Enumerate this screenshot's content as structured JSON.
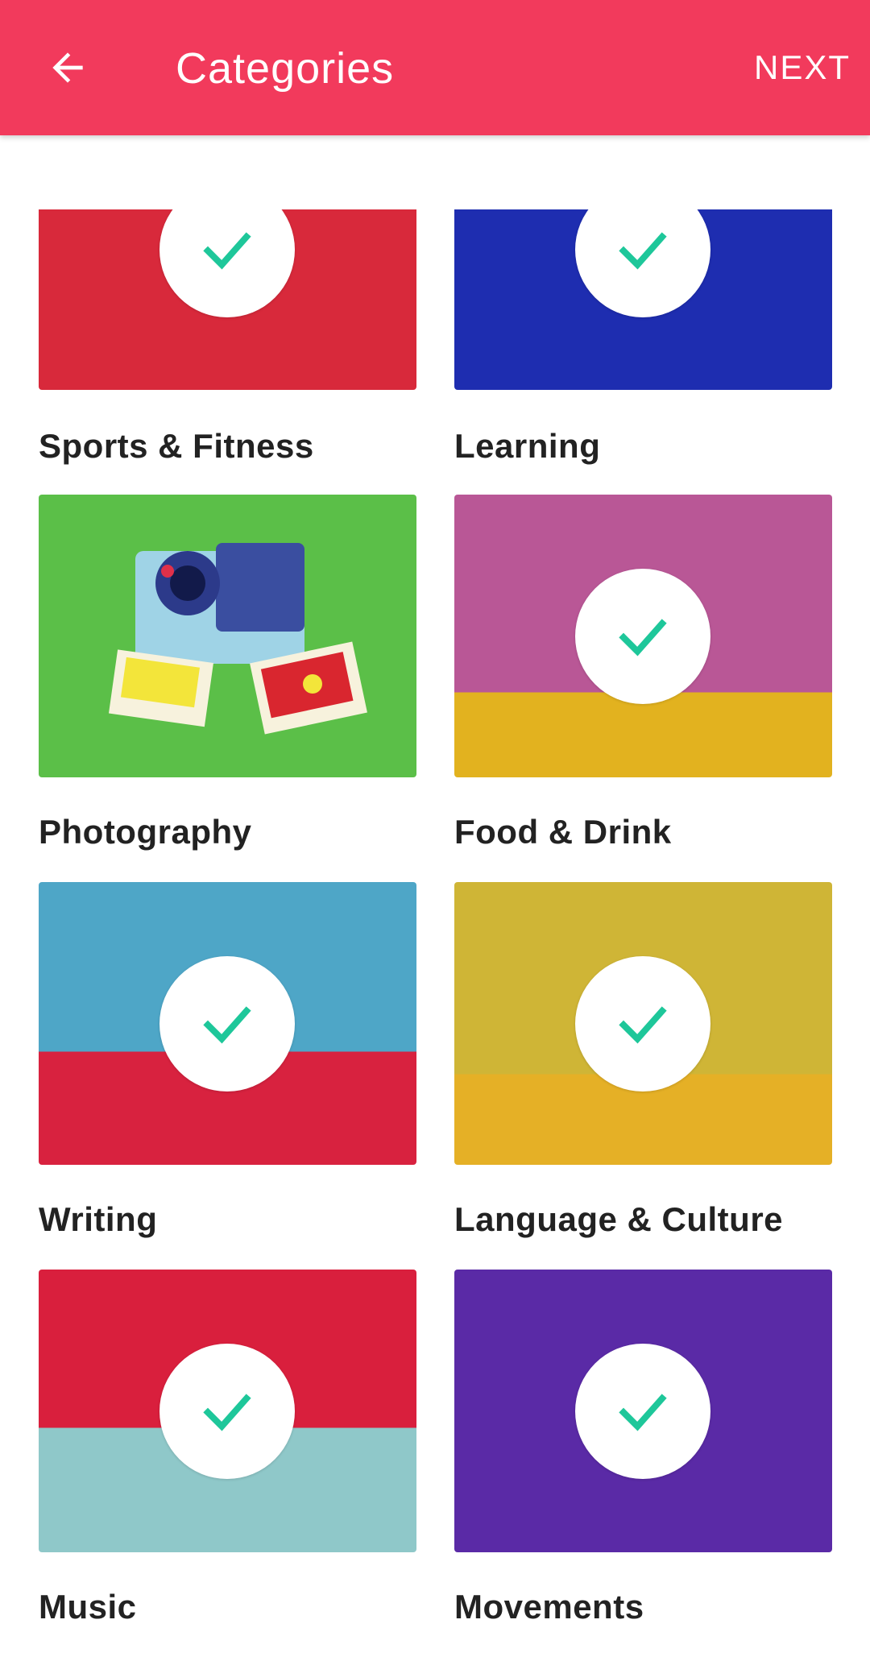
{
  "app_bar": {
    "title": "Categories",
    "next_label": "NEXT",
    "back_icon": "arrow-left-icon",
    "color": "#f23a5c"
  },
  "categories": [
    {
      "label": "Sports & Fitness",
      "selected": true
    },
    {
      "label": "Learning",
      "selected": true
    },
    {
      "label": "Photography",
      "selected": false
    },
    {
      "label": "Food & Drink",
      "selected": true
    },
    {
      "label": "Writing",
      "selected": true
    },
    {
      "label": "Language & Culture",
      "selected": true
    },
    {
      "label": "Music",
      "selected": true
    },
    {
      "label": "Movements",
      "selected": true
    }
  ],
  "check_color": "#1ec79a"
}
